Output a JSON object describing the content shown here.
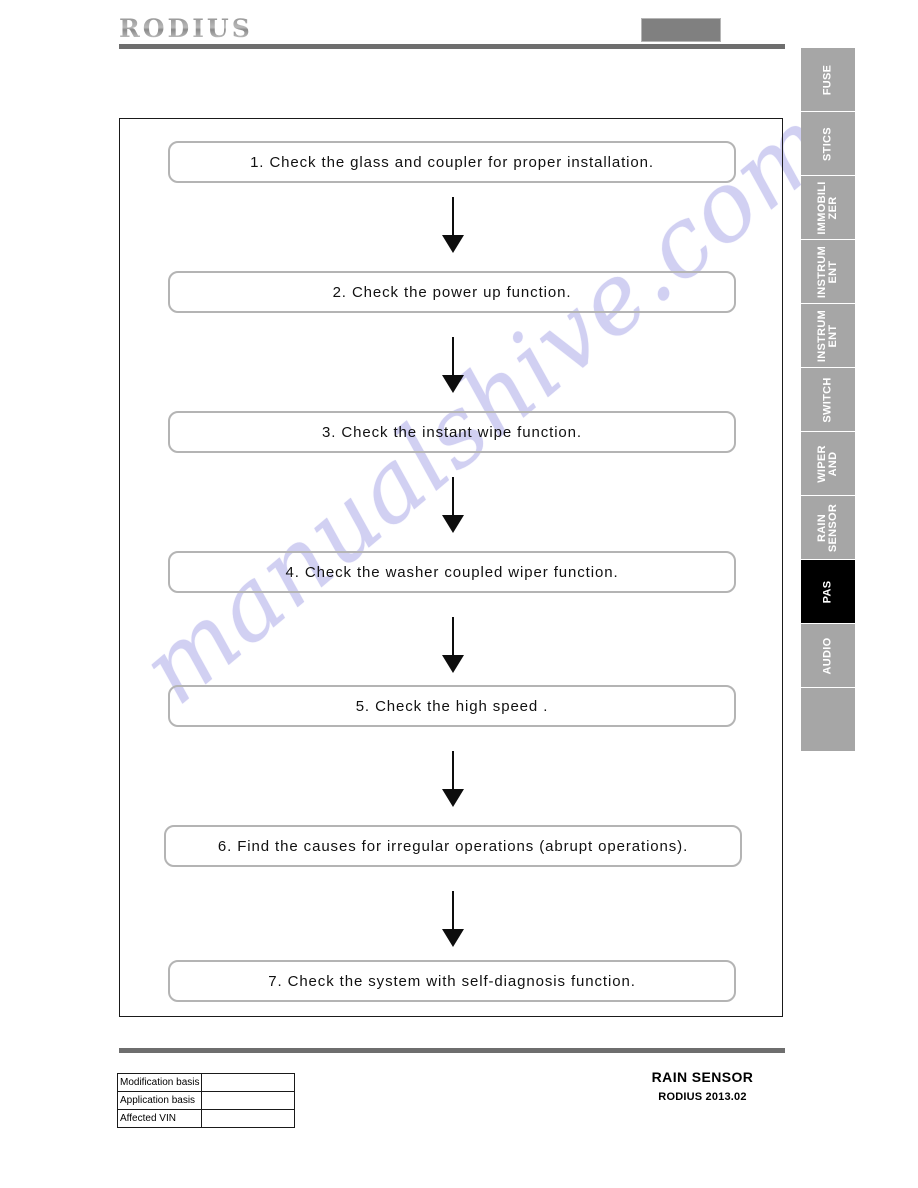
{
  "header": {
    "logo_text": "RODIUS",
    "gray_box": "",
    "gray_box_color": "#808080",
    "rule_color": "#6e6e6e"
  },
  "watermark": {
    "text": "manualshive.com",
    "color": "#c9c8f0"
  },
  "side_tabs": [
    {
      "label": "FUSE",
      "active": false
    },
    {
      "label": "STICS",
      "active": false
    },
    {
      "label": "IMMOBILI\nZER",
      "line1": "IMMOBILI",
      "line2": "ZER",
      "active": false
    },
    {
      "label": "INSTRUM\nENT",
      "line1": "INSTRUM",
      "line2": "ENT",
      "active": false
    },
    {
      "label": "INSTRUM\nENT",
      "line1": "INSTRUM",
      "line2": "ENT",
      "active": false
    },
    {
      "label": "SWITCH",
      "active": false
    },
    {
      "label": "WIPER\nAND",
      "line1": "WIPER",
      "line2": "AND",
      "active": false
    },
    {
      "label": "RAIN\nSENSOR",
      "line1": "RAIN",
      "line2": "SENSOR",
      "active": false
    },
    {
      "label": "PAS",
      "active": true
    },
    {
      "label": "AUDIO",
      "active": false
    },
    {
      "label": "",
      "active": false
    }
  ],
  "flowchart": {
    "steps": [
      {
        "text": "1. Check  the  glass  and  coupler  for  proper  installation."
      },
      {
        "text": "2. Check  the  power  up  function."
      },
      {
        "text": "3. Check  the  instant  wipe function."
      },
      {
        "text": "4. Check  the  washer  coupled  wiper  function."
      },
      {
        "text": "5. Check  the  high  speed ."
      },
      {
        "text": "6. Find  the  causes  for  irregular  operations   (abrupt  operations)."
      },
      {
        "text": "7. Check  the  system  with  self-diagnosis   function."
      }
    ]
  },
  "footer": {
    "table_rows": [
      {
        "label": "Modification basis",
        "value": ""
      },
      {
        "label": "Application basis",
        "value": ""
      },
      {
        "label": "Affected VIN",
        "value": ""
      }
    ],
    "section_name": "RAIN SENSOR",
    "model_date": "RODIUS 2013.02"
  }
}
